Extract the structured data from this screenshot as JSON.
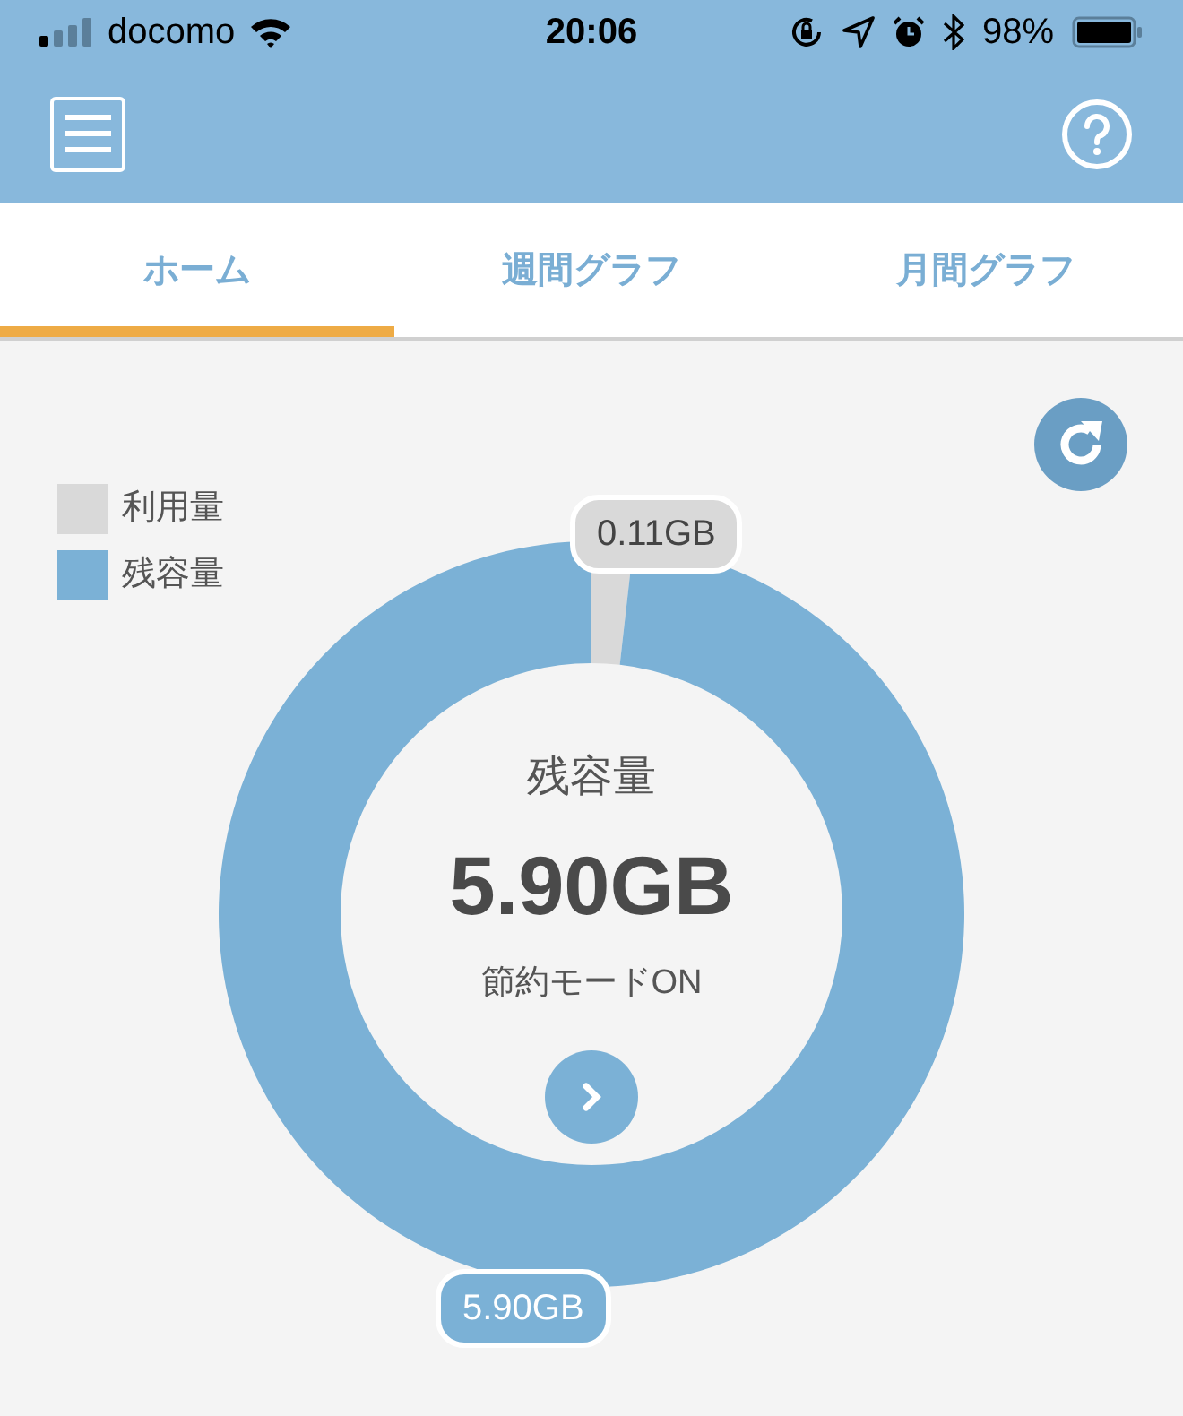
{
  "status_bar": {
    "carrier": "docomo",
    "time": "20:06",
    "battery": "98%"
  },
  "tabs": [
    {
      "label": "ホーム",
      "selected": true
    },
    {
      "label": "週間グラフ",
      "selected": false
    },
    {
      "label": "月間グラフ",
      "selected": false
    }
  ],
  "chart_data": {
    "type": "donut",
    "categories": [
      "利用量",
      "残容量"
    ],
    "colors": [
      "#d9d9d9",
      "#7bb1d6"
    ],
    "series": [
      {
        "values": [
          1.8,
          98.2
        ]
      }
    ],
    "legend": true,
    "value_labels": [
      "0.11GB",
      "5.90GB"
    ]
  },
  "center": {
    "label": "残容量",
    "value": "5.90GB",
    "mode": "節約モードON"
  }
}
